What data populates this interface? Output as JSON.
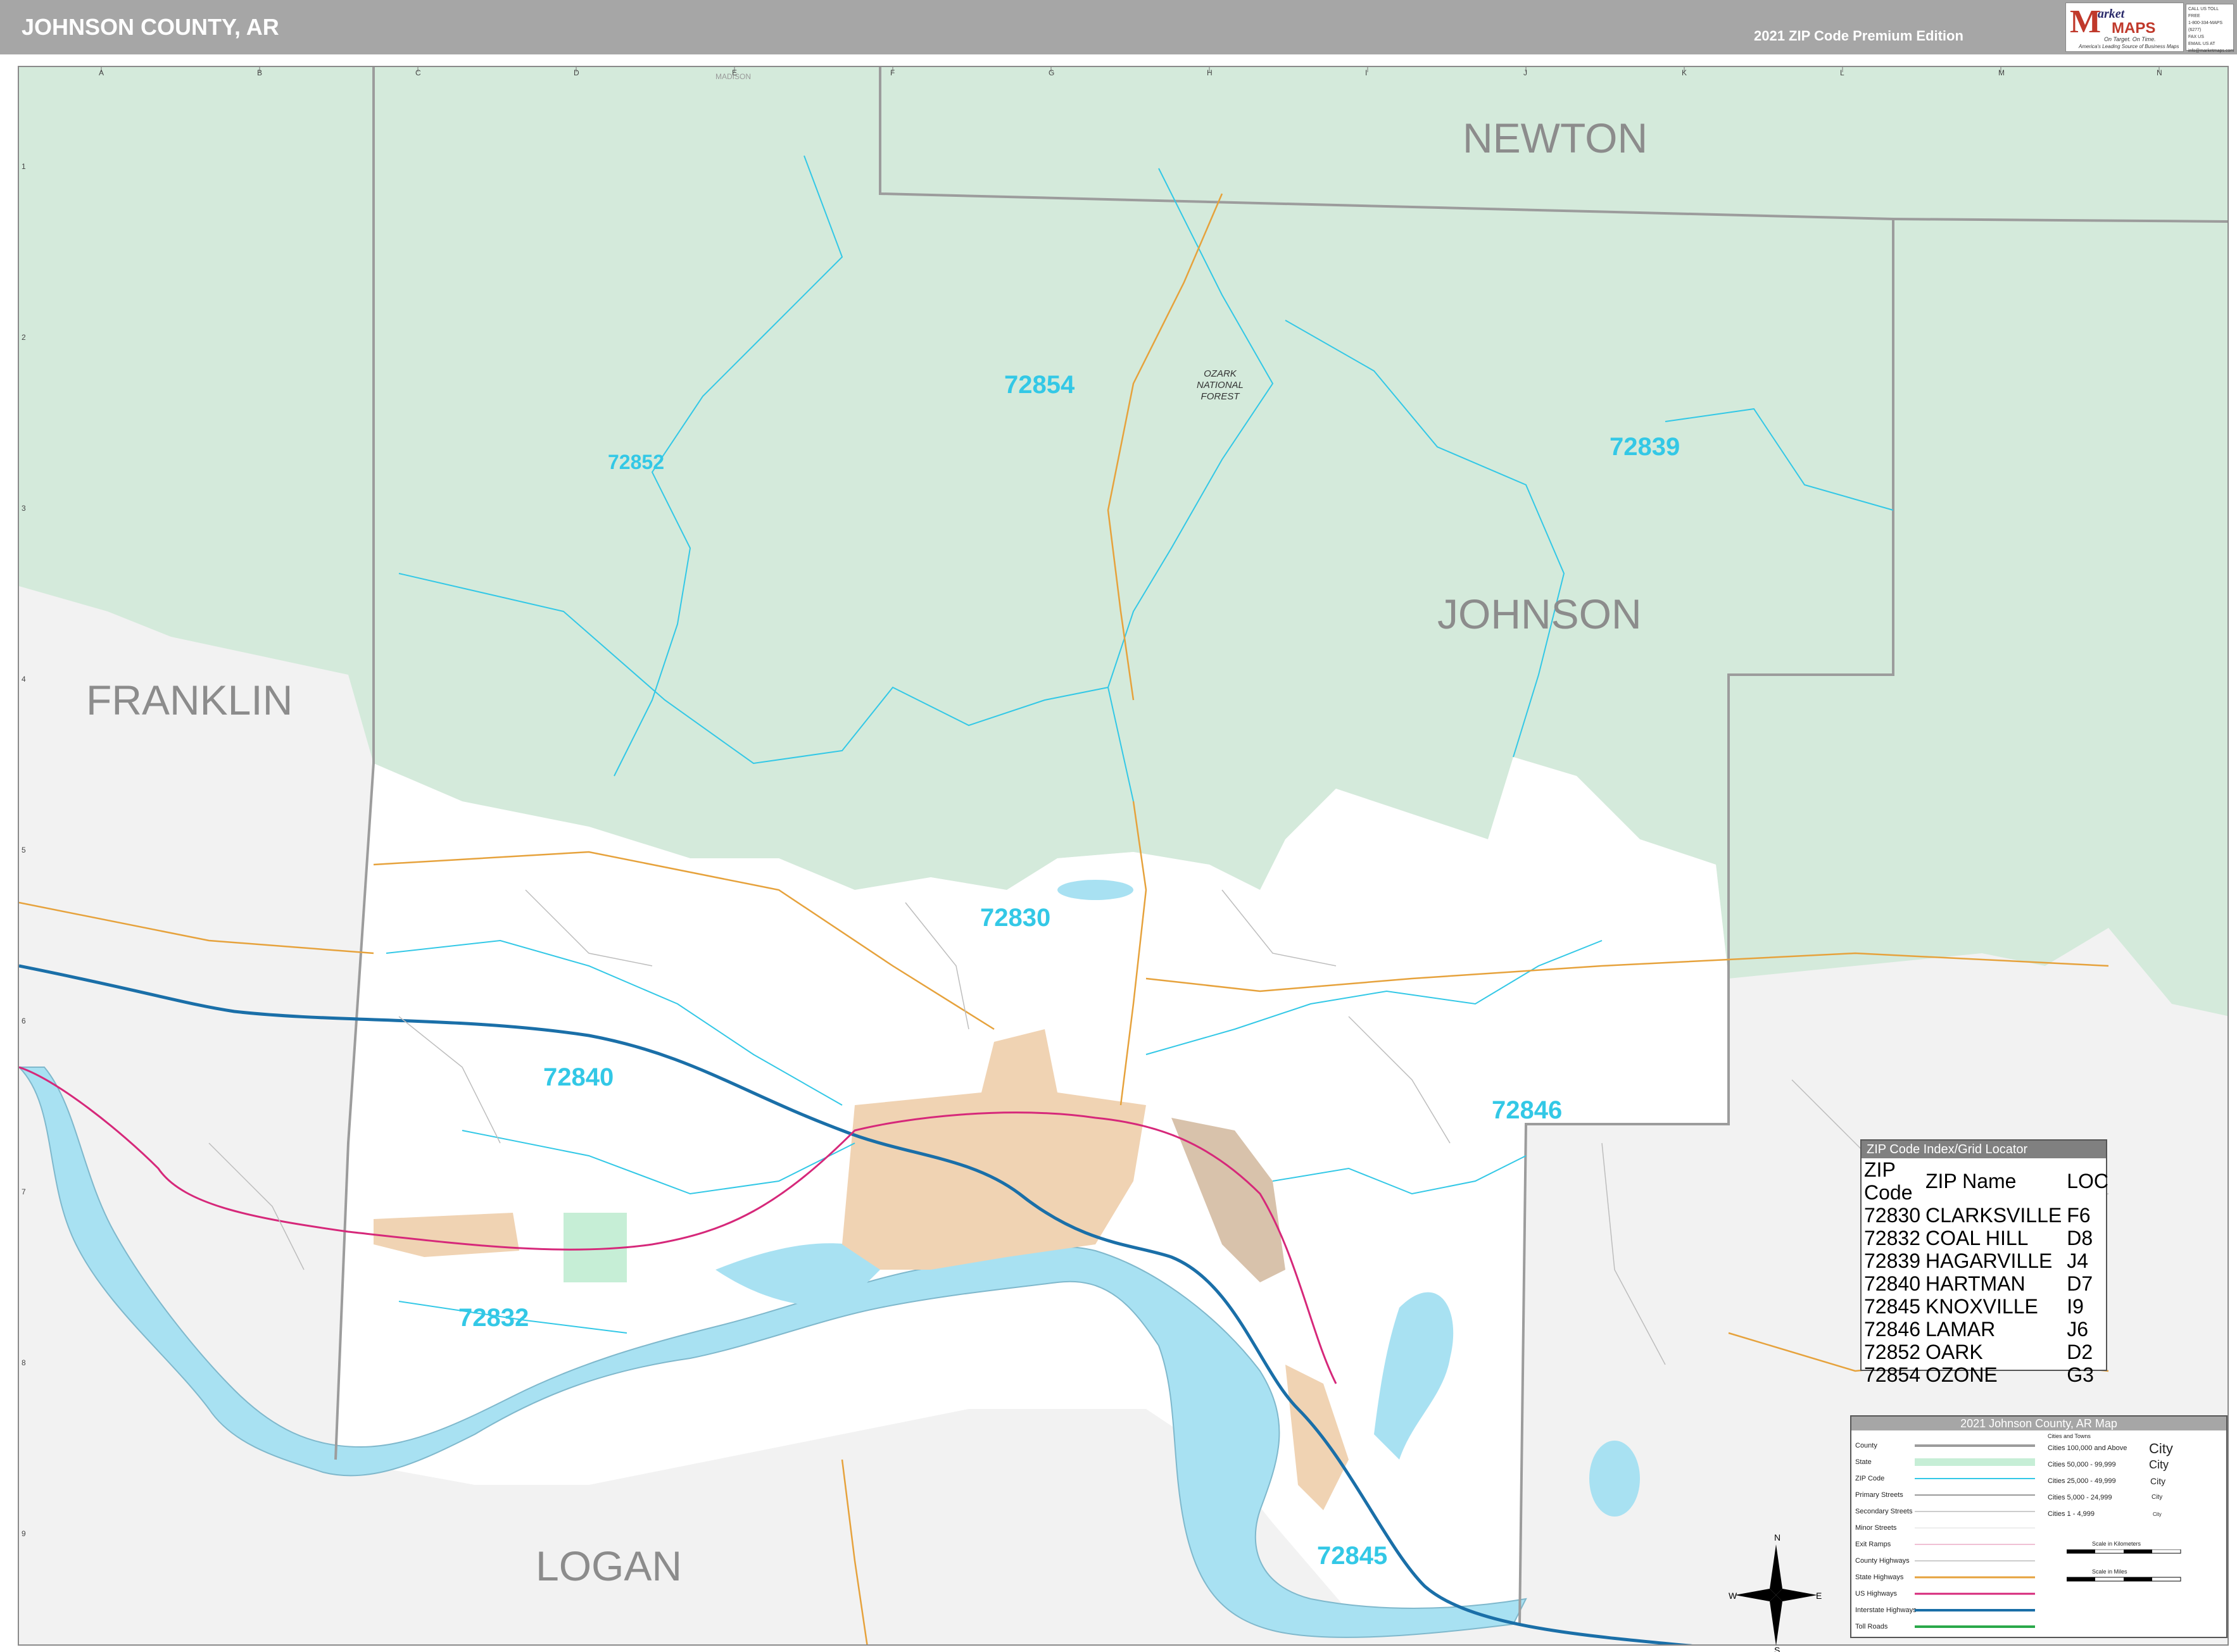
{
  "header": {
    "title": "JOHNSON COUNTY, AR",
    "edition": "2021 ZIP Code Premium Edition",
    "logo_m": "M",
    "logo_arket": "arket",
    "logo_maps": "MAPS",
    "logo_tag1": "On Target. On Time.",
    "logo_tag2": "America's Leading Source of Business Maps",
    "contact": [
      "CALL US TOLL FREE",
      "1-800-334-MAPS (6277)",
      "FAX US",
      "EMAIL US AT",
      "info@marketmaps.com"
    ]
  },
  "grid": {
    "columns": [
      "A",
      "B",
      "C",
      "D",
      "E",
      "F",
      "G",
      "H",
      "I",
      "J",
      "K",
      "L",
      "M",
      "N"
    ],
    "rows": [
      "1",
      "2",
      "3",
      "4",
      "5",
      "6",
      "7",
      "8",
      "9"
    ]
  },
  "counties": {
    "newton": "NEWTON",
    "johnson": "JOHNSON",
    "franklin": "FRANKLIN",
    "logan": "LOGAN",
    "madison": "MADISON"
  },
  "zips": [
    "72854",
    "72852",
    "72839",
    "72830",
    "72840",
    "72846",
    "72832",
    "72845"
  ],
  "forest_label": [
    "OZARK",
    "NATIONAL",
    "FOREST"
  ],
  "index": {
    "title": "ZIP Code Index/Grid Locator",
    "headers": [
      "ZIP Code",
      "ZIP Name",
      "LOC"
    ],
    "rows": [
      [
        "72830",
        "CLARKSVILLE",
        "F6"
      ],
      [
        "72832",
        "COAL HILL",
        "D8"
      ],
      [
        "72839",
        "HAGARVILLE",
        "J4"
      ],
      [
        "72840",
        "HARTMAN",
        "D7"
      ],
      [
        "72845",
        "KNOXVILLE",
        "I9"
      ],
      [
        "72846",
        "LAMAR",
        "J6"
      ],
      [
        "72852",
        "OARK",
        "D2"
      ],
      [
        "72854",
        "OZONE",
        "G3"
      ]
    ]
  },
  "legend": {
    "title": "2021 Johnson County, AR Map",
    "items": [
      "County",
      "State",
      "ZIP Code",
      "Primary Streets",
      "Secondary Streets",
      "Minor Streets",
      "Exit Ramps",
      "County Highways",
      "State Highways",
      "US Highways",
      "Interstate Highways",
      "Toll Roads"
    ],
    "cities_header": "Cities and Towns",
    "city_classes": [
      {
        "range": "Cities 100,000 and Above",
        "sample": "City"
      },
      {
        "range": "Cities 50,000 - 99,999",
        "sample": "City"
      },
      {
        "range": "Cities 25,000 - 49,999",
        "sample": "City"
      },
      {
        "range": "Cities 5,000 - 24,999",
        "sample": "City"
      },
      {
        "range": "Cities 1 - 4,999",
        "sample": "City"
      }
    ],
    "scale_km": "Scale in Kilometers",
    "scale_mi": "Scale in Miles"
  },
  "compass": {
    "n": "N",
    "s": "S",
    "e": "E",
    "w": "W"
  },
  "colors": {
    "forest": "#d4eadb",
    "water": "#a8e1f2",
    "urban": "#f0d3b3",
    "zip_line": "#33c8e6",
    "interstate": "#1a6fa8",
    "us_highway": "#d6287a",
    "state_highway": "#e6a23c"
  }
}
